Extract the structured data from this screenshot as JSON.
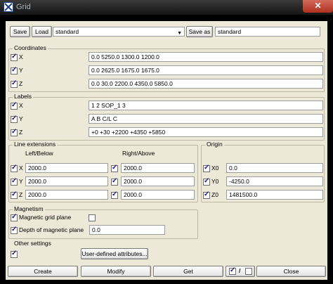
{
  "window": {
    "title": "Grid",
    "close_glyph": "✕"
  },
  "toolbar": {
    "save": "Save",
    "load": "Load",
    "preset_value": "standard",
    "save_as": "Save as",
    "save_as_value": "standard"
  },
  "coordinates": {
    "legend": "Coordinates",
    "x": {
      "label": "X",
      "value": "0.0 5250.0 1300.0 1200.0"
    },
    "y": {
      "label": "Y",
      "value": "0.0 2625.0 1675.0 1675.0"
    },
    "z": {
      "label": "Z",
      "value": "0.0 30.0 2200.0 4350.0 5850.0"
    }
  },
  "labels": {
    "legend": "Labels",
    "x": {
      "label": "X",
      "value": "1 2 SOP_1 3"
    },
    "y": {
      "label": "Y",
      "value": "A B C/L C"
    },
    "z": {
      "label": "Z",
      "value": "+0 +30 +2200 +4350 +5850"
    }
  },
  "line_extensions": {
    "legend": "Line extensions",
    "left_below_header": "Left/Below",
    "right_above_header": "Right/Above",
    "x": {
      "label": "X",
      "left": "2000.0",
      "right": "2000.0"
    },
    "y": {
      "label": "Y",
      "left": "2000.0",
      "right": "2000.0"
    },
    "z": {
      "label": "Z",
      "left": "2000.0",
      "right": "2000.0"
    }
  },
  "origin": {
    "legend": "Origin",
    "x0": {
      "label": "X0",
      "value": "0.0"
    },
    "y0": {
      "label": "Y0",
      "value": "-4250.0"
    },
    "z0": {
      "label": "Z0",
      "value": "1481500.0"
    }
  },
  "magnetism": {
    "legend": "Magnetism",
    "grid_plane_label": "Magnetic grid plane",
    "depth_label": "Depth of magnetic plane",
    "depth_value": "0.0"
  },
  "other_settings": {
    "legend": "Other settings",
    "uda_button": "User-defined attributes..."
  },
  "footer": {
    "create": "Create",
    "modify": "Modify",
    "get": "Get",
    "toggle_sep": "/",
    "close": "Close"
  }
}
